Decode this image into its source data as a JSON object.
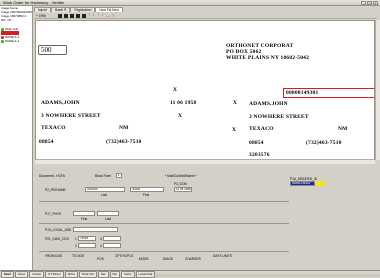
{
  "window": {
    "title": "Work Order for Hadnsecy - Verifier"
  },
  "leftpanel": {
    "lines": [
      "Image Name",
      "Image 2007000012345",
      "Image 18373882.4",
      "NO: n%"
    ],
    "tree": [
      {
        "label": "Work Unit",
        "state": "green"
      },
      {
        "label": "",
        "state": "selected"
      },
      {
        "label": "NODE-F-1",
        "state": "red"
      },
      {
        "label": "NODE-F-1",
        "state": "green"
      }
    ]
  },
  "tabs": [
    "Import",
    "Batch R",
    "Registration",
    "Next Fld Next"
  ],
  "toolbar": {
    "zoom": "+  1996"
  },
  "document": {
    "left_box": "500",
    "company_name": "ORTHONET CORPORAT",
    "company_po": "PO BOX 5062",
    "company_city": "WHITE PLAINS NY  10602-5042",
    "mark_x1": "X",
    "id_number": "00800149301",
    "patient_name": "ADAMS,JOHN",
    "dob": "11  06  1958",
    "sex_mark": "X",
    "insured_name": "ADAMS,JOHN",
    "patient_street": "3 NOWHERE STREET",
    "street_mark": "X",
    "insured_street": "3 NOWHERE STREET",
    "patient_city": "TEXACO",
    "patient_state": "NM",
    "city_mark": "X",
    "insured_city": "TEXACO",
    "insured_state": "NM",
    "patient_zip": "08854",
    "patient_phone": "(732)463-7510",
    "insured_zip": "08854",
    "insured_phone": "(732)463-7510",
    "bottom_number": "3203576"
  },
  "form": {
    "doc_label": "Document - HCFA",
    "block_label": "Block Form",
    "block_value": "1",
    "hint": "* Mult/Go/Med/Name *",
    "p2_label": "P2_PATNAME",
    "p2_last": "ADAMS",
    "p2_first": "JOHN",
    "p2_last_sub": "Last",
    "p2_first_sub": "First",
    "p3_label": "P3_DOB",
    "p3_value": "11 06 1958",
    "p1a_label": "P1A_INSURED_ID",
    "p1a_value": "00800149301",
    "p17_label": "P17_PHYS",
    "p17_sub1": "First",
    "p17_sub2": "Last",
    "p19_label": "P19_LOCAL_USE",
    "p21_label": "P21_DIAG_CDS",
    "p21_num1": "1",
    "p21_val1": "71515",
    "p21_num2": "3",
    "p21_num3": "2",
    "p21_num4": "4",
    "line_headers": [
      "FROM DOS",
      "TO DOS",
      "POS",
      "CPT/HCPCS",
      "MODS",
      "DIAGS",
      "CHARGES",
      "DAYS UNITS"
    ]
  },
  "taskbar": {
    "items": [
      "Start",
      "Inbox",
      "Cortex",
      "CT Direct",
      "Micro",
      "Prod Ctrl",
      "Net",
      "Ptp",
      "Verify",
      "Local Disk"
    ]
  }
}
